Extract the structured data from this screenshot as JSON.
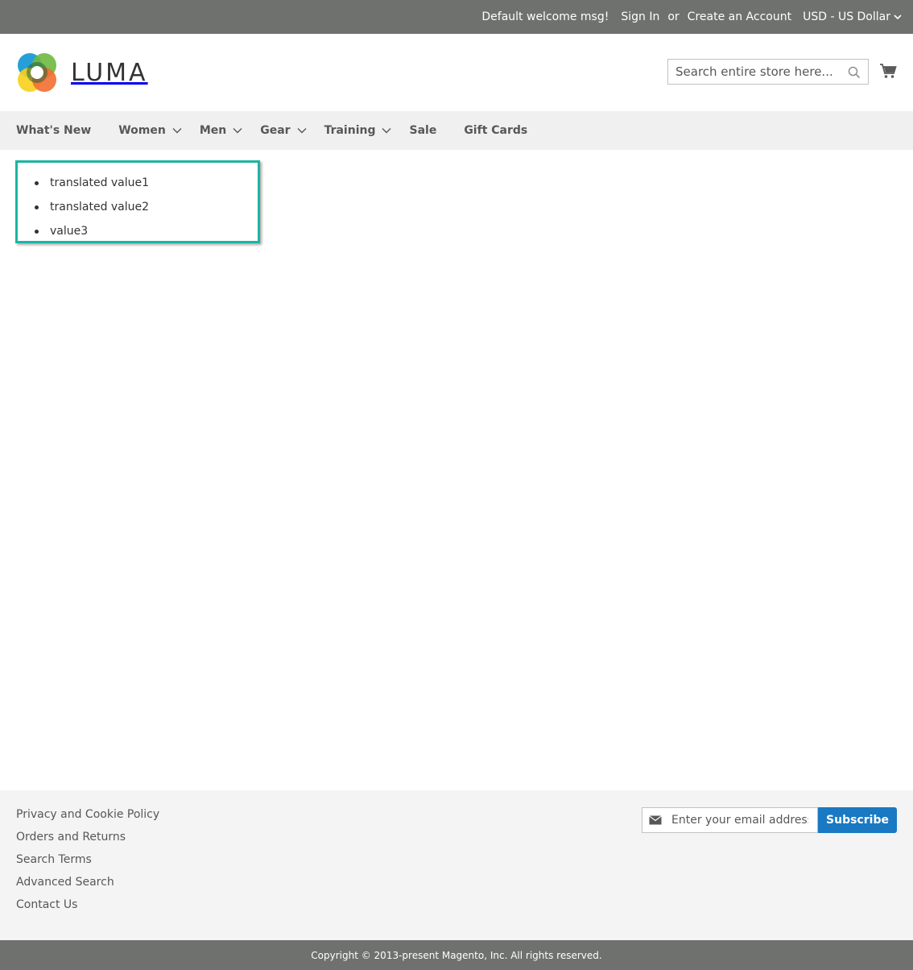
{
  "topbar": {
    "welcome": "Default welcome msg!",
    "sign_in": "Sign In",
    "or": "or",
    "create_account": "Create an Account",
    "currency": "USD - US Dollar"
  },
  "header": {
    "logo_text": "LUMA",
    "search_placeholder": "Search entire store here...",
    "search_value": ""
  },
  "nav": {
    "items": [
      {
        "label": "What's New"
      },
      {
        "label": "Women"
      },
      {
        "label": "Men"
      },
      {
        "label": "Gear"
      },
      {
        "label": "Training"
      },
      {
        "label": "Sale"
      },
      {
        "label": "Gift Cards"
      }
    ]
  },
  "content": {
    "items": [
      "translated value1",
      "translated value2",
      "value3"
    ]
  },
  "footer": {
    "links": [
      "Privacy and Cookie Policy",
      "Orders and Returns",
      "Search Terms",
      "Advanced Search",
      "Contact Us"
    ],
    "newsletter_placeholder": "Enter your email address",
    "subscribe_label": "Subscribe",
    "copyright": "Copyright © 2013-present Magento, Inc. All rights reserved."
  },
  "colors": {
    "topbar_bg": "#6e716e",
    "nav_bg": "#f0f0f0",
    "highlight_border": "#1cb5a3",
    "subscribe_bg": "#1979c3"
  }
}
